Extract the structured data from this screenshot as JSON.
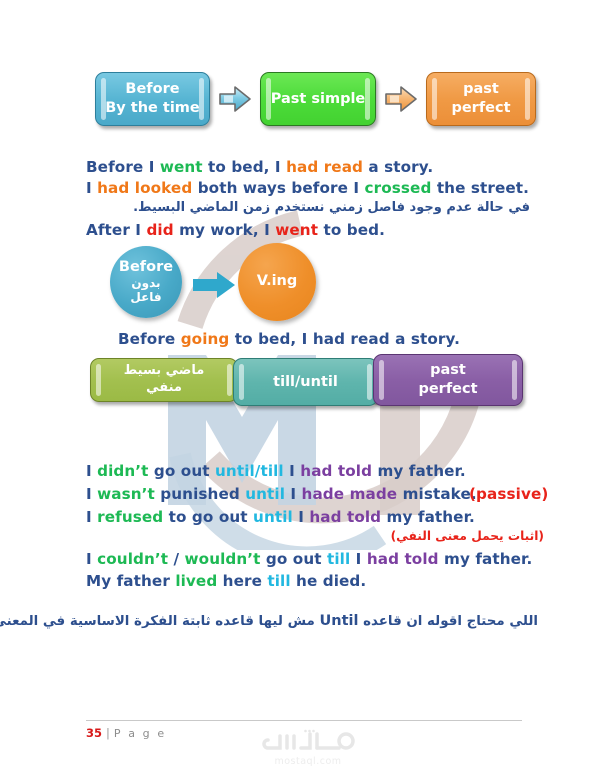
{
  "document": {
    "page_number": "35",
    "page_label": "P a g e",
    "separator": "|",
    "watermark_brand_ar": "مستقل",
    "watermark_brand_latin": "mostaql.com"
  },
  "colors": {
    "navy_text": "#2d4f8e",
    "green_text": "#1db954",
    "orange_text": "#f07818",
    "red_text": "#e8231a",
    "cyan_text": "#22b8e0",
    "purple_text": "#7b3fa0",
    "box_blue": "#57b5d3",
    "box_green": "#4ddc3a",
    "box_orange": "#f09a45",
    "box_olive": "#a3c04f",
    "box_teal": "#5fb5ad",
    "box_purple": "#8a5fa6",
    "page_number_red": "#d81a1a"
  },
  "diagram_one": {
    "name": "before-past-simple-past-perfect-flow",
    "boxes": [
      {
        "id": "before-by-the-time",
        "lines": [
          "Before",
          "By the time"
        ],
        "color": "#57b5d3"
      },
      {
        "id": "past-simple",
        "lines": [
          "Past simple"
        ],
        "color": "#4ddc3a"
      },
      {
        "id": "past-perfect",
        "lines": [
          "past",
          "perfect"
        ],
        "color": "#f09a45"
      }
    ],
    "arrows": [
      {
        "id": "arrow-1",
        "color": "#57b5d3",
        "direction": "right"
      },
      {
        "id": "arrow-2",
        "color": "#f09a45",
        "direction": "right"
      }
    ]
  },
  "examples_one": {
    "line1": [
      {
        "t": "Before I ",
        "c": "navy"
      },
      {
        "t": "went",
        "c": "green"
      },
      {
        "t": " to bed, I ",
        "c": "navy"
      },
      {
        "t": "had read",
        "c": "orange"
      },
      {
        "t": " a story.",
        "c": "navy"
      }
    ],
    "line2": [
      {
        "t": "I ",
        "c": "navy"
      },
      {
        "t": "had looked",
        "c": "orange"
      },
      {
        "t": " both ways before I ",
        "c": "navy"
      },
      {
        "t": "crossed",
        "c": "green"
      },
      {
        "t": " the street.",
        "c": "navy"
      }
    ],
    "arabic_note": "في حالة عدم وجود فاصل زمني نستخدم زمن الماضي البسيط.",
    "line3": [
      {
        "t": "After I ",
        "c": "navy"
      },
      {
        "t": "did",
        "c": "red"
      },
      {
        "t": " my work, I ",
        "c": "navy"
      },
      {
        "t": "went",
        "c": "red"
      },
      {
        "t": " to bed.",
        "c": "navy"
      }
    ]
  },
  "diagram_two": {
    "name": "before-v-ing-circles",
    "circle_left": {
      "id": "before-circle",
      "en": "Before",
      "ar_line1": "بدون",
      "ar_line2": "فاعل",
      "color": "#48a9c8"
    },
    "arrow": {
      "id": "arrow-blue",
      "color": "#2fa8cc",
      "direction": "right"
    },
    "circle_right": {
      "id": "v-ing-circle",
      "en": "V.ing",
      "color": "#ef8f2a"
    }
  },
  "examples_two": {
    "line1": [
      {
        "t": "Before ",
        "c": "navy"
      },
      {
        "t": "going",
        "c": "orange"
      },
      {
        "t": " to bed, I had read a story.",
        "c": "navy"
      }
    ]
  },
  "diagram_three": {
    "name": "negative-past-till-until-past-perfect-flow",
    "boxes": [
      {
        "id": "past-simple-negative-ar",
        "lines": [
          "ماضي بسيط",
          "منفي"
        ],
        "rtl": true,
        "color": "#a3c04f"
      },
      {
        "id": "till-until",
        "lines": [
          "till/until"
        ],
        "rtl": false,
        "color": "#5fb5ad"
      },
      {
        "id": "past-perfect",
        "lines": [
          "past",
          "perfect"
        ],
        "rtl": false,
        "color": "#8a5fa6"
      }
    ]
  },
  "examples_three": {
    "line1": [
      {
        "t": "I ",
        "c": "navy"
      },
      {
        "t": "didn’t",
        "c": "green"
      },
      {
        "t": " go out ",
        "c": "navy"
      },
      {
        "t": "until/till",
        "c": "cyan"
      },
      {
        "t": " I ",
        "c": "navy"
      },
      {
        "t": "had told",
        "c": "purple"
      },
      {
        "t": " my father.",
        "c": "navy"
      }
    ],
    "line2": [
      {
        "t": "I ",
        "c": "navy"
      },
      {
        "t": "wasn’t",
        "c": "green"
      },
      {
        "t": " punished ",
        "c": "navy"
      },
      {
        "t": "until",
        "c": "cyan"
      },
      {
        "t": " I ",
        "c": "navy"
      },
      {
        "t": "hade made",
        "c": "purple"
      },
      {
        "t": " mistake.",
        "c": "navy"
      }
    ],
    "line2_tag": "(passive)",
    "line3": [
      {
        "t": "I ",
        "c": "navy"
      },
      {
        "t": "refused",
        "c": "green"
      },
      {
        "t": " to go out ",
        "c": "navy"
      },
      {
        "t": "until",
        "c": "cyan"
      },
      {
        "t": " I ",
        "c": "navy"
      },
      {
        "t": "had told",
        "c": "purple"
      },
      {
        "t": " my father.",
        "c": "navy"
      }
    ],
    "arabic_note_red": "(اثبات يحمل معنى النفي)",
    "line4": [
      {
        "t": "I ",
        "c": "navy"
      },
      {
        "t": "couldn’t",
        "c": "green"
      },
      {
        "t": " / ",
        "c": "navy"
      },
      {
        "t": "wouldn’t",
        "c": "green"
      },
      {
        "t": " go out ",
        "c": "navy"
      },
      {
        "t": "till",
        "c": "cyan"
      },
      {
        "t": " I ",
        "c": "navy"
      },
      {
        "t": "had told",
        "c": "purple"
      },
      {
        "t": " my father.",
        "c": "navy"
      }
    ],
    "line5": [
      {
        "t": "My father ",
        "c": "navy"
      },
      {
        "t": "lived",
        "c": "green"
      },
      {
        "t": " here ",
        "c": "navy"
      },
      {
        "t": "till",
        "c": "cyan"
      },
      {
        "t": " he died.",
        "c": "navy"
      }
    ]
  },
  "closing_note": {
    "part_right": "اللي محتاج اقوله ان قاعده",
    "keyword": "Until",
    "part_left": "مش ليها قاعده ثابتة الفكرة الاساسية في المعني."
  }
}
